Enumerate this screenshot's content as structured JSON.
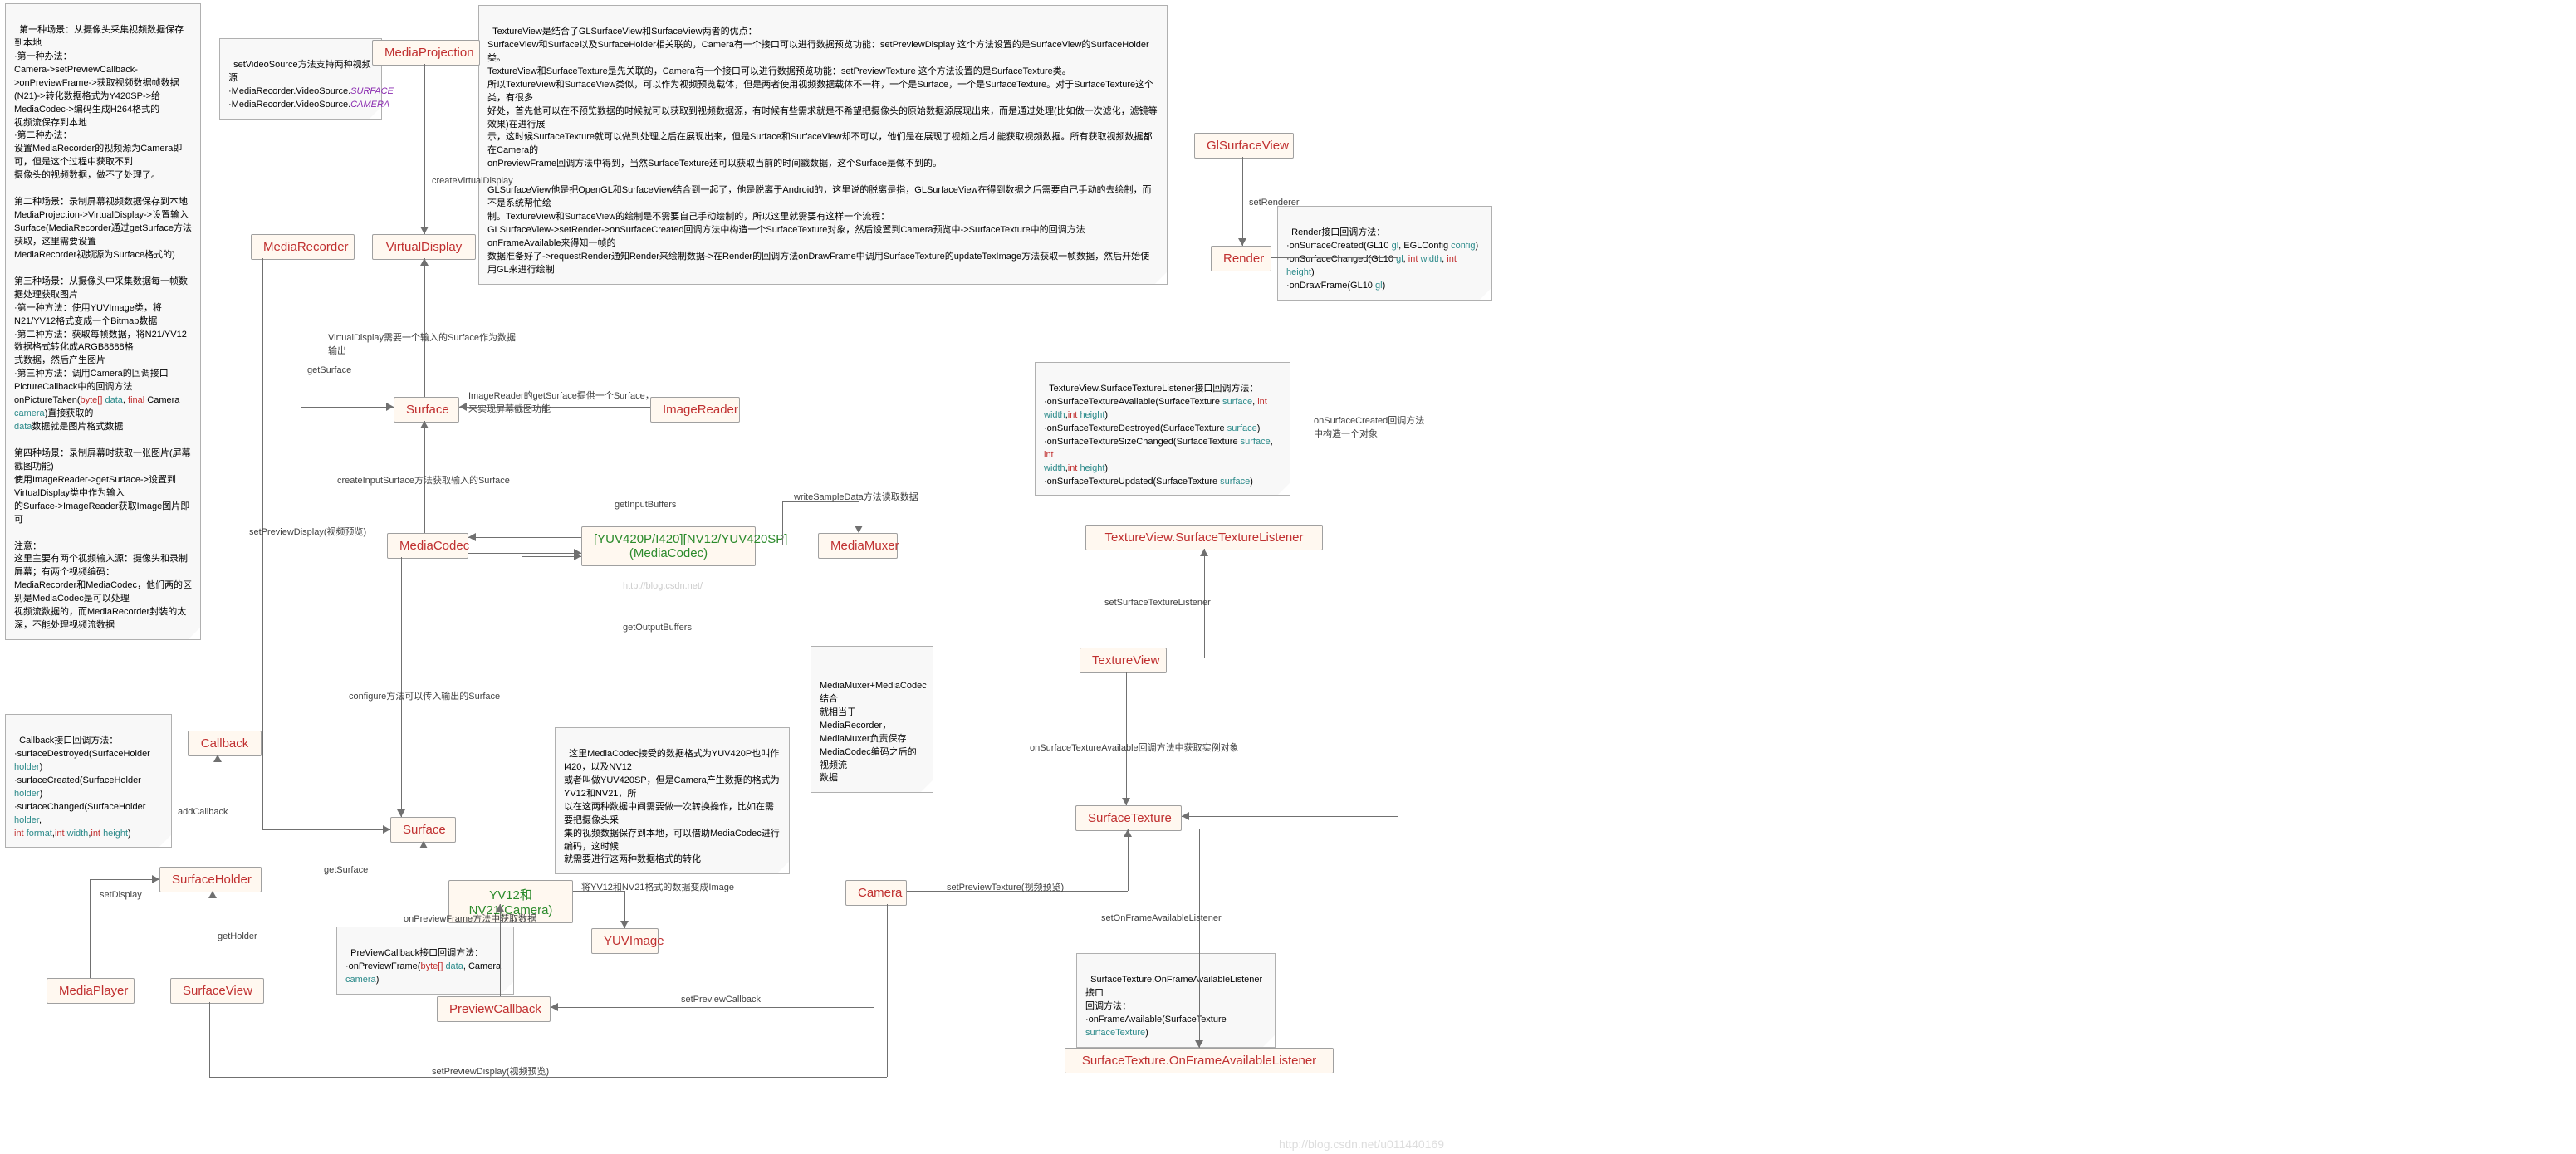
{
  "nodes": {
    "mediaProjection": "MediaProjection",
    "mediaRecorder": "MediaRecorder",
    "virtualDisplay": "VirtualDisplay",
    "surface1": "Surface",
    "imageReader": "ImageReader",
    "mediaCodec": "MediaCodec",
    "yuv420p": "[YUV420P/I420][NV12/YUV420SP]\n(MediaCodec)",
    "mediaMuxer": "MediaMuxer",
    "callback": "Callback",
    "surface2": "Surface",
    "surfaceHolder": "SurfaceHolder",
    "surfaceView": "SurfaceView",
    "mediaPlayer": "MediaPlayer",
    "yv12nv21": "YV12和NV21(Camera)",
    "yuvImage": "YUVImage",
    "camera": "Camera",
    "previewCallback": "PreviewCallback",
    "glSurfaceView": "GlSurfaceView",
    "render": "Render",
    "tvSurfTexListener": "TextureView.SurfaceTextureListener",
    "textureView": "TextureView",
    "surfaceTexture": "SurfaceTexture",
    "stOnFrameAvail": "SurfaceTexture.OnFrameAvailableListener"
  },
  "labels": {
    "createVirtualDisplay": "createVirtualDisplay",
    "virtualDisplaySurface": "VirtualDisplay需要一个输入的Surface作为数据输出",
    "getSurface": "getSurface",
    "imageReaderGetSurface": "ImageReader的getSurface提供一个Surface，\n来实现屏幕截图功能",
    "createInputSurface": "createInputSurface方法获取输入的Surface",
    "getInputBuffers": "getInputBuffers",
    "writeSampleData": "writeSampleData方法读取数据",
    "getOutputBuffers": "getOutputBuffers",
    "blogUrl": "http://blog.csdn.net/",
    "configure": "configure方法可以传入输出的Surface",
    "setPreviewDisplay1": "setPreviewDisplay(视频预览)",
    "addCallback": "addCallback",
    "getSurface2": "getSurface",
    "setDisplay": "setDisplay",
    "getHolder": "getHolder",
    "onPreviewFrame": "onPreviewFrame方法中获取数据",
    "yv12ToImage": "将YV12和NV21格式的数据变成Image",
    "setPreviewCallback": "setPreviewCallback",
    "setPreviewDisplay2": "setPreviewDisplay(视频预览)",
    "setPreviewTexture": "setPreviewTexture(视频预览)",
    "setOnFrameAvailListener": "setOnFrameAvailableListener",
    "onSurfTexAvail": "onSurfaceTextureAvailable回调方法中获取实例对象",
    "setSurfTexListener": "setSurfaceTextureListener",
    "setRenderer": "setRenderer",
    "onSurfCreated": "onSurfaceCreated回调方法\n中构造一个对象"
  },
  "notes": {
    "bigLeft": "第一种场景：从摄像头采集视频数据保存到本地\n·第一种办法：\nCamera->setPreviewCallback->onPreviewFrame->获取视频数据帧数据\n(N21)->转化数据格式为Y420SP->给MediaCodec->编码生成H264格式的\n视频流保存到本地\n·第二种办法：\n设置MediaRecorder的视频源为Camera即可，但是这个过程中获取不到\n摄像头的视频数据，做不了处理了。\n\n第二种场景：录制屏幕视频数据保存到本地\nMediaProjection->VirtualDisplay->设置输入\nSurface(MediaRecorder通过getSurface方法获取，这里需要设置\nMediaRecorder视频源为Surface格式的)\n\n第三种场景：从摄像头中采集数据每一帧数据处理获取图片\n·第一种方法：使用YUVImage类，将N21/YV12格式变成一个Bitmap数据\n·第二种方法：获取每帧数据，将N21/YV12数据格式转化成ARGB8888格\n式数据，然后产生图片\n·第三种方法：调用Camera的回调接口PictureCallback中的回调方法\nonPictureTaken(byte[] data, final Camera camera)直接获取的\ndata数据就是图片格式数据\n\n第四种场景：录制屏幕时获取一张图片(屏幕截图功能)\n使用ImageReader->getSurface->设置到VirtualDisplay类中作为输入\n的Surface->ImageReader获取Image图片即可\n\n注意：\n这里主要有两个视频输入源：摄像头和录制屏幕；有两个视频编码：\nMediaRecorder和MediaCodec，他们两的区别是MediaCodec是可以处理\n视频流数据的，而MediaRecorder封装的太深，不能处理视频流数据",
    "setVideoSource": "setVideoSource方法支持两种视频源\n·MediaRecorder.VideoSource.SURFACE\n·MediaRecorder.VideoSource.CAMERA",
    "callbackNote": "Callback接口回调方法：\n·surfaceDestroyed(SurfaceHolder\nholder)\n·surfaceCreated(SurfaceHolder holder)\n·surfaceChanged(SurfaceHolder holder,\nint format,int width,int height)",
    "previewCbNote": "PreViewCallback接口回调方法：\n·onPreviewFrame(byte[] data, Camera\ncamera)",
    "mediaCodecNote": "这里MediaCodec接受的数据格式为YUV420P也叫作I420，以及NV12\n或者叫做YUV420SP，但是Camera产生数据的格式为YV12和NV21，所\n以在这两种数据中间需要做一次转换操作，比如在需要把摄像头采\n集的视频数据保存到本地，可以借助MediaCodec进行编码，这时候\n就需要进行这两种数据格式的转化",
    "mediaMuxerNote": "MediaMuxer+MediaCodec结合\n就相当于MediaRecorder，\nMediaMuxer负责保存\nMediaCodec编码之后的视频流\n数据",
    "bigTop": "TextureView是结合了GLSurfaceView和SurfaceView两者的优点：\nSurfaceView和Surface以及SurfaceHolder相关联的，Camera有一个接口可以进行数据预览功能：setPreviewDisplay 这个方法设置的是SurfaceView的SurfaceHolder类。\nTextureView和SurfaceTexture是先关联的，Camera有一个接口可以进行数据预览功能：setPreviewTexture 这个方法设置的是SurfaceTexture类。\n所以TextureView和SurfaceView类似，可以作为视频预览载体，但是两者使用视频数据载体不一样，一个是Surface，一个是SurfaceTexture。对于SurfaceTexture这个类，有很多\n好处，首先他可以在不预览数据的时候就可以获取到视频数据源，有时候有些需求就是不希望把摄像头的原始数据源展现出来，而是通过处理(比如做一次滤化，滤镜等效果)在进行展\n示，这时候SurfaceTexture就可以做到处理之后在展现出来，但是Surface和SurfaceView却不可以，他们是在展现了视频之后才能获取视频数据。所有获取视频数据都在Camera的\nonPreviewFrame回调方法中得到，当然SurfaceTexture还可以获取当前的时间戳数据，这个Surface是做不到的。\n\nGLSurfaceView他是把OpenGL和SurfaceView结合到一起了，他是脱离于Android的，这里说的脱离是指，GLSurfaceView在得到数据之后需要自己手动的去绘制，而不是系统帮忙绘\n制。TextureView和SurfaceView的绘制是不需要自己手动绘制的，所以这里就需要有这样一个流程：\nGLSurfaceView->setRender->onSurfaceCreated回调方法中构造一个SurfaceTexture对象，然后设置到Camera预览中->SurfaceTexture中的回调方法onFrameAvailable来得知一帧的\n数据准备好了->requestRender通知Render来绘制数据->在Render的回调方法onDrawFrame中调用SurfaceTexture的updateTexImage方法获取一帧数据，然后开始使用GL来进行绘制",
    "renderNote": "Render接口回调方法：\n·onSurfaceCreated(GL10 gl, EGLConfig config)\n·onSurfaceChanged(GL10 gl, int width, int height)\n·onDrawFrame(GL10 gl)",
    "tvListenerNote": "TextureView.SurfaceTextureListener接口回调方法：\n·onSurfaceTextureAvailable(SurfaceTexture surface, int\nwidth,int height)\n·onSurfaceTextureDestroyed(SurfaceTexture surface)\n·onSurfaceTextureSizeChanged(SurfaceTexture surface, int\nwidth,int height)\n·onSurfaceTextureUpdated(SurfaceTexture surface)",
    "stListenerNote": "SurfaceTexture.OnFrameAvailableListener接口\n回调方法：\n·onFrameAvailable(SurfaceTexture\nsurfaceTexture)"
  },
  "watermarks": {
    "w1": "http://blog.csdn.net/u011440169"
  }
}
